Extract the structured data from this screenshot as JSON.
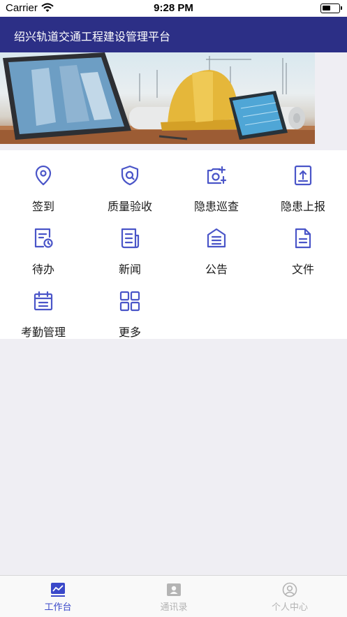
{
  "status_bar": {
    "carrier": "Carrier",
    "time": "9:28 PM"
  },
  "nav": {
    "title": "绍兴轨道交通工程建设管理平台"
  },
  "colors": {
    "accent": "#2c2f86",
    "icon": "#4a55c8",
    "tab_inactive": "#b4b4b4"
  },
  "grid": {
    "items": [
      {
        "label": "签到",
        "icon": "location-pin-icon"
      },
      {
        "label": "质量验收",
        "icon": "shield-check-icon"
      },
      {
        "label": "隐患巡查",
        "icon": "camera-add-icon"
      },
      {
        "label": "隐患上报",
        "icon": "upload-document-icon"
      },
      {
        "label": "待办",
        "icon": "todo-clock-icon"
      },
      {
        "label": "新闻",
        "icon": "news-icon"
      },
      {
        "label": "公告",
        "icon": "announcement-icon"
      },
      {
        "label": "文件",
        "icon": "file-icon"
      },
      {
        "label": "考勤管理",
        "icon": "calendar-icon"
      },
      {
        "label": "更多",
        "icon": "more-grid-icon"
      }
    ]
  },
  "tabs": [
    {
      "label": "工作台",
      "icon": "chart-trend-icon",
      "active": true
    },
    {
      "label": "通讯录",
      "icon": "contacts-icon",
      "active": false
    },
    {
      "label": "个人中心",
      "icon": "user-profile-icon",
      "active": false
    }
  ]
}
